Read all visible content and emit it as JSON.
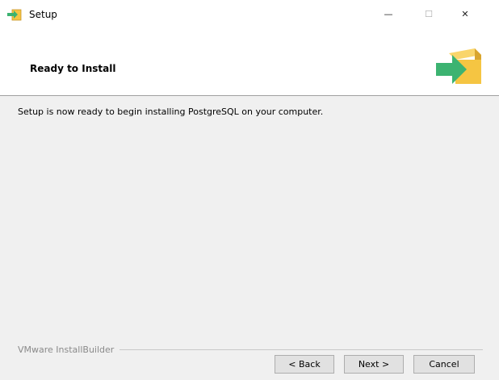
{
  "window": {
    "title": "Setup",
    "icon": "install-box-icon",
    "controls": {
      "minimize": "—",
      "maximize": "☐",
      "close": "✕"
    }
  },
  "header": {
    "title": "Ready to Install",
    "graphic": "install-box-arrow-icon"
  },
  "content": {
    "message": "Setup is now ready to begin installing PostgreSQL on your computer."
  },
  "footer": {
    "brand": "VMware InstallBuilder",
    "back_label": "< Back",
    "next_label": "Next >",
    "cancel_label": "Cancel"
  },
  "colors": {
    "box": "#f5c542",
    "arrow": "#3cb371",
    "background": "#f0f0f0"
  }
}
